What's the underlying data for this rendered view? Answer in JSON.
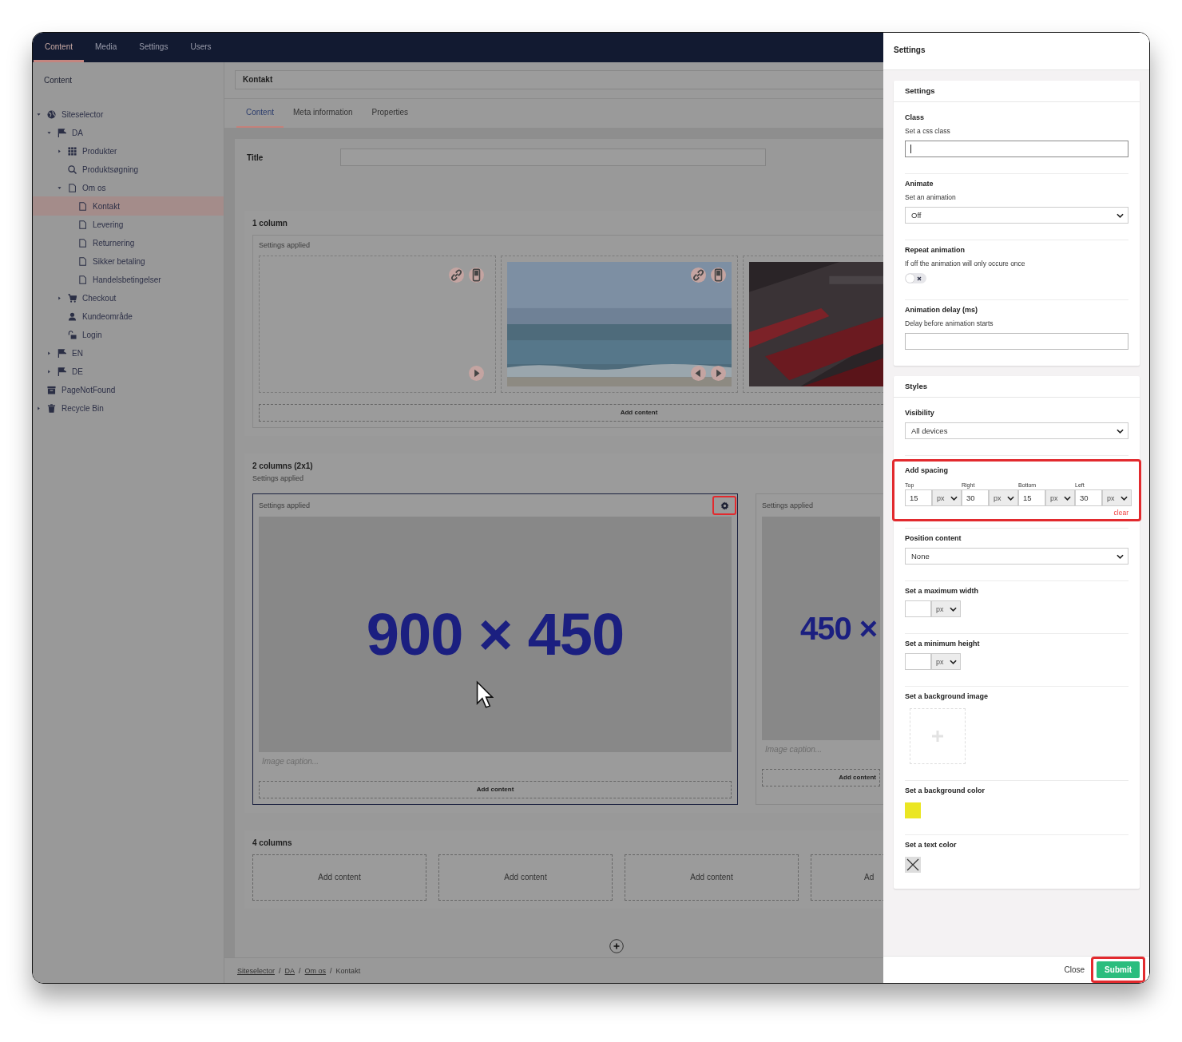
{
  "top_nav": [
    {
      "label": "Content",
      "selected": true
    },
    {
      "label": "Media",
      "selected": false
    },
    {
      "label": "Settings",
      "selected": false
    },
    {
      "label": "Users",
      "selected": false
    }
  ],
  "sidebar": {
    "title": "Content",
    "tree": [
      {
        "label": "Siteselector",
        "kind": "globe",
        "selected": false,
        "expanded": true,
        "children": [
          {
            "label": "DA",
            "kind": "flag",
            "selected": false,
            "expanded": true,
            "children": [
              {
                "label": "Produkter",
                "kind": "grid",
                "selected": false,
                "expanded": false
              },
              {
                "label": "Produktsøgning",
                "kind": "search",
                "selected": false
              },
              {
                "label": "Om os",
                "kind": "page",
                "selected": false,
                "expanded": true,
                "children": [
                  {
                    "label": "Kontakt",
                    "kind": "page",
                    "selected": true
                  },
                  {
                    "label": "Levering",
                    "kind": "page",
                    "selected": false
                  },
                  {
                    "label": "Returnering",
                    "kind": "page",
                    "selected": false
                  },
                  {
                    "label": "Sikker betaling",
                    "kind": "page",
                    "selected": false
                  },
                  {
                    "label": "Handelsbetingelser",
                    "kind": "page",
                    "selected": false
                  }
                ]
              },
              {
                "label": "Checkout",
                "kind": "cart",
                "selected": false,
                "expanded": false
              },
              {
                "label": "Kundeområde",
                "kind": "user",
                "selected": false
              },
              {
                "label": "Login",
                "kind": "lock",
                "selected": false
              }
            ]
          },
          {
            "label": "EN",
            "kind": "flag",
            "selected": false,
            "expanded": false
          },
          {
            "label": "DE",
            "kind": "flag",
            "selected": false,
            "expanded": false
          }
        ]
      },
      {
        "label": "PageNotFound",
        "kind": "archive",
        "selected": false
      },
      {
        "label": "Recycle Bin",
        "kind": "trash",
        "selected": false,
        "expanded": false
      }
    ]
  },
  "editor": {
    "node_name": "Kontakt",
    "tabs": [
      {
        "label": "Content",
        "selected": true
      },
      {
        "label": "Meta information",
        "selected": false
      },
      {
        "label": "Properties",
        "selected": false
      }
    ],
    "title_field": {
      "label": "Title"
    },
    "sections": [
      {
        "kind": "gallery",
        "title": "1 column",
        "settings_note": "Settings applied",
        "cells": [
          {
            "kind": "empty"
          },
          {
            "kind": "picture",
            "controls": true
          },
          {
            "kind": "picture"
          }
        ],
        "add_label": "Add content"
      },
      {
        "kind": "columns",
        "title": "2 columns (2x1)",
        "settings_note": "Settings applied",
        "columns": [
          {
            "selected": true,
            "highlighted": true,
            "settings_note": "Settings applied",
            "image_text": "900 × 450",
            "caption_placeholder": "Image caption...",
            "add_label": "Add content"
          },
          {
            "selected": false,
            "settings_note": "Settings applied",
            "image_text": "450 ×",
            "caption_placeholder": "Image caption...",
            "add_label": "Add content"
          }
        ]
      },
      {
        "kind": "cells",
        "title": "4 columns",
        "cells": [
          "Add content",
          "Add content",
          "Add content",
          "Ad"
        ]
      }
    ],
    "breadcrumb_separator": "/",
    "breadcrumbs": [
      {
        "label": "Siteselector",
        "link": true
      },
      {
        "label": "DA",
        "link": true
      },
      {
        "label": "Om os",
        "link": true
      },
      {
        "label": "Kontakt",
        "link": false
      }
    ]
  },
  "settings_panel": {
    "title": "Settings",
    "cards": [
      {
        "title": "Settings",
        "fields": [
          {
            "kind": "text",
            "label": "Class",
            "hint": "Set a css class",
            "focused": true
          },
          {
            "kind": "select",
            "label": "Animate",
            "hint": "Set an animation",
            "value": "Off"
          },
          {
            "kind": "toggle",
            "label": "Repeat animation",
            "hint": "If off the animation will only occure once",
            "on": false
          },
          {
            "kind": "text",
            "label": "Animation delay (ms)",
            "hint": "Delay before animation starts",
            "focused": false
          }
        ]
      },
      {
        "title": "Styles",
        "fields": [
          {
            "kind": "select",
            "label": "Visibility",
            "value": "All devices"
          },
          {
            "kind": "spacing",
            "label": "Add spacing",
            "highlighted": true,
            "clear": "clear",
            "sides": [
              {
                "label": "Top",
                "value": "15",
                "unit": "px"
              },
              {
                "label": "Right",
                "value": "30",
                "unit": "px"
              },
              {
                "label": "Bottom",
                "value": "15",
                "unit": "px"
              },
              {
                "label": "Left",
                "value": "30",
                "unit": "px"
              }
            ]
          },
          {
            "kind": "select",
            "label": "Position content",
            "value": "None"
          },
          {
            "kind": "unit",
            "label": "Set a maximum width",
            "unit": "px"
          },
          {
            "kind": "unit",
            "label": "Set a minimum height",
            "unit": "px"
          },
          {
            "label": "Set a background image"
          },
          {
            "kind": "color",
            "label": "Set a background color",
            "color": "#ebe623"
          },
          {
            "kind": "color",
            "label": "Set a text color"
          }
        ]
      }
    ],
    "close": "Close",
    "submit": "Submit",
    "submit_highlighted": true
  }
}
